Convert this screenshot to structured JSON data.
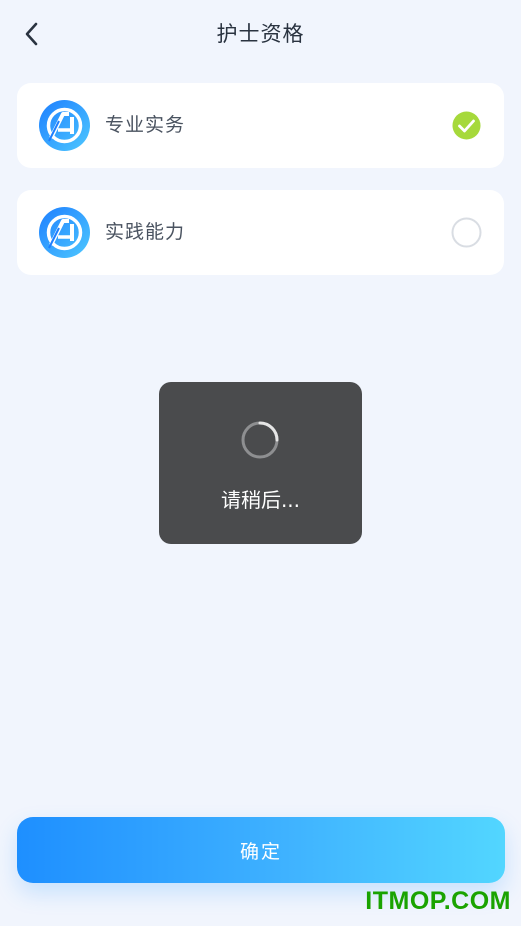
{
  "header": {
    "title": "护士资格",
    "back_icon": "chevron-left-icon"
  },
  "options": [
    {
      "label": "专业实务",
      "selected": true,
      "logo_icon": "app-logo-icon"
    },
    {
      "label": "实践能力",
      "selected": false,
      "logo_icon": "app-logo-icon"
    }
  ],
  "loading": {
    "text": "请稍后...",
    "icon": "spinner-icon"
  },
  "footer": {
    "confirm_label": "确定"
  },
  "watermark": {
    "text": "ITMOP.COM"
  },
  "colors": {
    "background": "#f1f5fd",
    "check_green": "#a6d93b",
    "brand_blue": "#1e8fff",
    "toast_bg": "#4a4b4d",
    "watermark_green": "#1aa300"
  }
}
